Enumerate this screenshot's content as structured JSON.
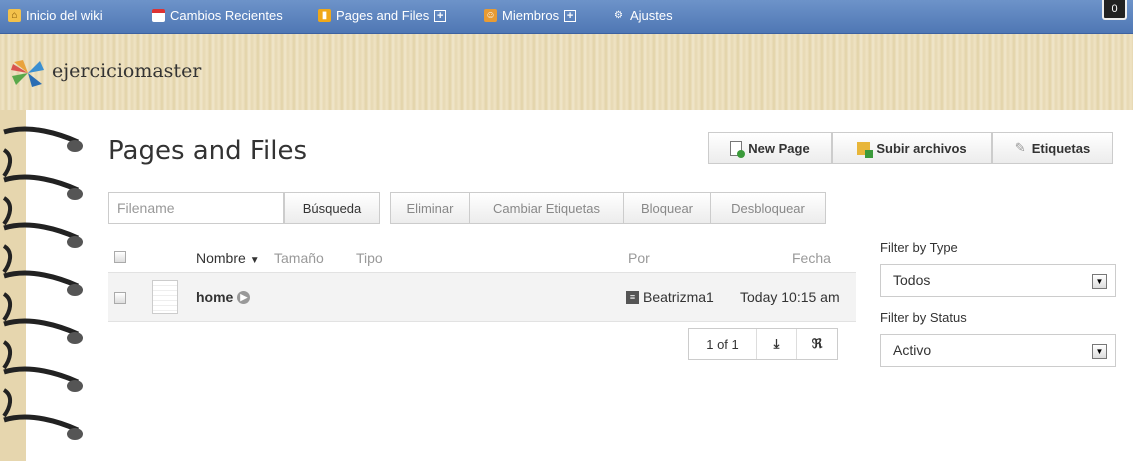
{
  "nav": {
    "home": "Inicio del wiki",
    "recent": "Cambios Recientes",
    "pages": "Pages and Files",
    "members": "Miembros",
    "settings": "Ajustes",
    "counter": "0"
  },
  "wiki": {
    "name": "ejerciciomaster"
  },
  "page": {
    "title": "Pages and Files"
  },
  "actions": {
    "new_page": "New Page",
    "upload": "Subir archivos",
    "tags": "Etiquetas"
  },
  "search": {
    "placeholder": "Filename",
    "button": "Búsqueda"
  },
  "bulk": {
    "delete": "Eliminar",
    "change_tags": "Cambiar Etiquetas",
    "lock": "Bloquear",
    "unlock": "Desbloquear"
  },
  "table": {
    "columns": {
      "name": "Nombre",
      "size": "Tamaño",
      "type": "Tipo",
      "by": "Por",
      "date": "Fecha"
    },
    "rows": [
      {
        "name": "home",
        "by": "Beatrizma1",
        "date": "Today 10:15 am"
      }
    ]
  },
  "pager": {
    "label": "1 of 1"
  },
  "filters": {
    "type_label": "Filter by Type",
    "type_value": "Todos",
    "status_label": "Filter by Status",
    "status_value": "Activo"
  },
  "colors": {
    "nav_bar": "#5b82bf",
    "accent": "#333333"
  }
}
